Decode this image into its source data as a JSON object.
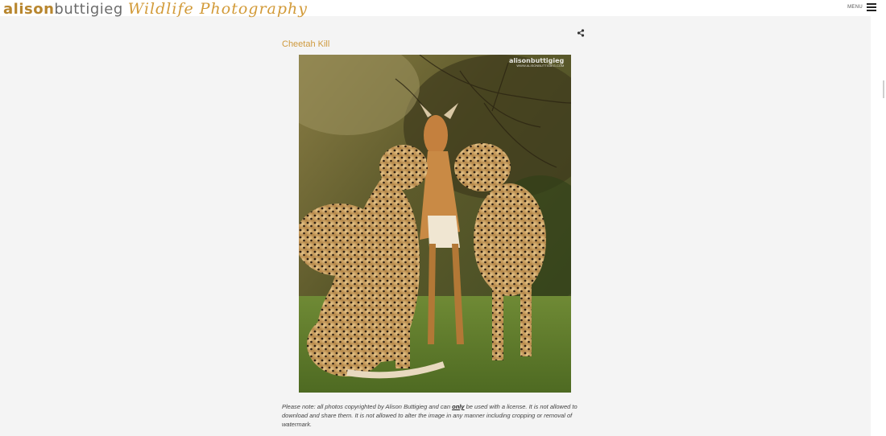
{
  "header": {
    "logo_first": "alison",
    "logo_last": "buttigieg",
    "logo_tagline": "Wildlife Photography",
    "menu_label": "MENU"
  },
  "icons": {
    "menu": "hamburger-icon",
    "share": "share-icon"
  },
  "colors": {
    "accent": "#cf9a3e",
    "logo_gold": "#b8862e",
    "logo_grey": "#6b6b6b",
    "background": "#f4f4f4"
  },
  "photo": {
    "title": "Cheetah Kill",
    "watermark_main": "alisonbuttigieg",
    "watermark_sub": "WWW.ALISONBUTTIGIEG.COM"
  },
  "notice": {
    "part1": "Please note: all photos copyrighted by Alison Buttigieg and can ",
    "emphasis": "only",
    "part2": " be used with a license.  It is not allowed to download and share them.  It is not allowed to alter the image in any manner including cropping or removal of watermark."
  }
}
